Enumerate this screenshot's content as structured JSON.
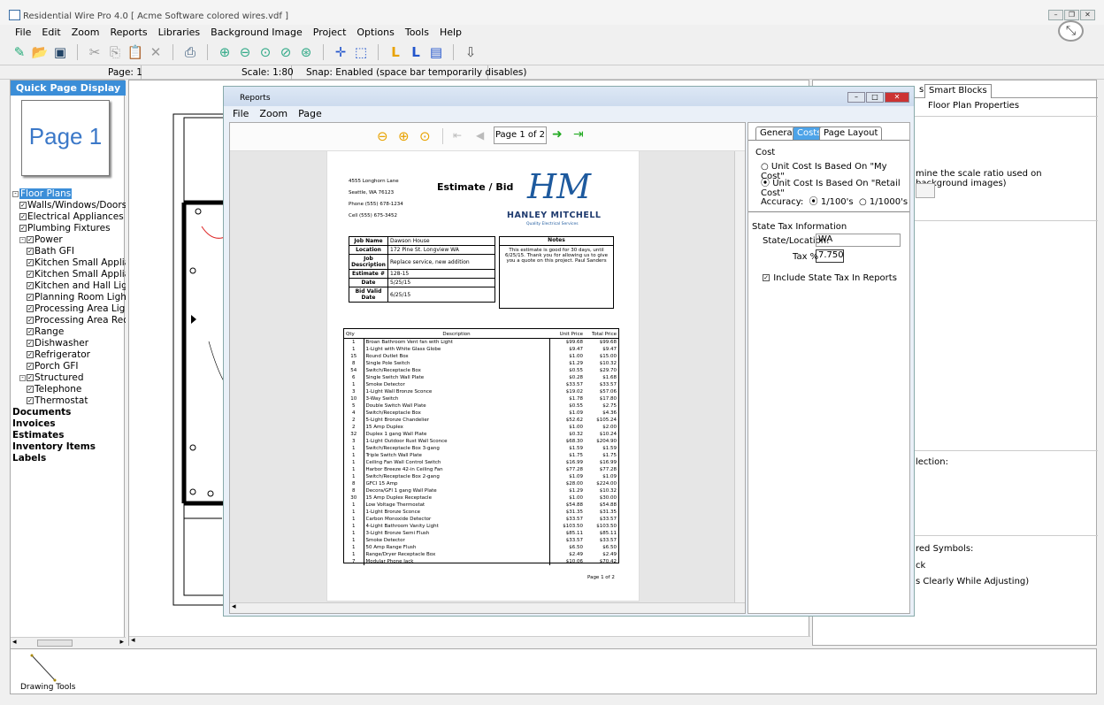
{
  "window": {
    "title": "Residential Wire Pro 4.0 [ Acme Software colored wires.vdf ]"
  },
  "menu": [
    "File",
    "Edit",
    "Zoom",
    "Reports",
    "Libraries",
    "Background Image",
    "Project",
    "Options",
    "Tools",
    "Help"
  ],
  "status": {
    "page": "Page: 1",
    "scale": "Scale: 1:80",
    "snap": "Snap: Enabled  (space bar temporarily disables)"
  },
  "left": {
    "header": "Quick Page Display",
    "thumb": "Page 1",
    "tree": [
      {
        "t": "Floor Plans",
        "lvl": 0,
        "exp": "-",
        "sel": true
      },
      {
        "t": "Walls/Windows/Doors",
        "lvl": 1,
        "cb": true
      },
      {
        "t": "Electrical Appliances",
        "lvl": 1,
        "cb": true
      },
      {
        "t": "Plumbing Fixtures",
        "lvl": 1,
        "cb": true
      },
      {
        "t": "Power",
        "lvl": 1,
        "cb": true,
        "exp": "-"
      },
      {
        "t": "Bath GFI",
        "lvl": 2,
        "cb": true
      },
      {
        "t": "Kitchen Small Applianc",
        "lvl": 2,
        "cb": true
      },
      {
        "t": "Kitchen Small Applianc",
        "lvl": 2,
        "cb": true
      },
      {
        "t": "Kitchen and Hall Lightin",
        "lvl": 2,
        "cb": true
      },
      {
        "t": "Planning Room Lights (",
        "lvl": 2,
        "cb": true
      },
      {
        "t": "Processing Area Lights",
        "lvl": 2,
        "cb": true
      },
      {
        "t": "Processing Area Rece",
        "lvl": 2,
        "cb": true
      },
      {
        "t": "Range",
        "lvl": 2,
        "cb": true
      },
      {
        "t": "Dishwasher",
        "lvl": 2,
        "cb": true
      },
      {
        "t": "Refrigerator",
        "lvl": 2,
        "cb": true
      },
      {
        "t": "Porch GFI",
        "lvl": 2,
        "cb": true
      },
      {
        "t": "Structured",
        "lvl": 1,
        "cb": true,
        "exp": "-"
      },
      {
        "t": "Telephone",
        "lvl": 2,
        "cb": true
      },
      {
        "t": "Thermostat",
        "lvl": 2,
        "cb": true
      },
      {
        "t": "Documents",
        "lvl": 0,
        "bold": true
      },
      {
        "t": "Invoices",
        "lvl": 0,
        "bold": true
      },
      {
        "t": "Estimates",
        "lvl": 0,
        "bold": true
      },
      {
        "t": "Inventory Items",
        "lvl": 0,
        "bold": true
      },
      {
        "t": "Labels",
        "lvl": 0,
        "bold": true
      }
    ]
  },
  "bottom": {
    "label": "Drawing Tools"
  },
  "right": {
    "tab_partial": "s",
    "tab_smart": "Smart Blocks",
    "heading": "Floor Plan Properties",
    "text1": "mine the scale ratio used on background images)",
    "text2": "lection:",
    "text3": "red Symbols:",
    "text4": "ck",
    "text5": "s Clearly While Adjusting)"
  },
  "reports": {
    "title": "Reports",
    "menu": [
      "File",
      "Zoom",
      "Page"
    ],
    "page_box": "Page 1 of 2",
    "tabs": [
      "General",
      "Costs",
      "Page Layout"
    ],
    "cost_label": "Cost",
    "opt1": "Unit Cost Is Based On \"My Cost\"",
    "opt2": "Unit Cost Is Based On \"Retail Cost\"",
    "accuracy_label": "Accuracy:",
    "acc1": "1/100's",
    "acc2": "1/1000's",
    "state_tax": "State Tax Information",
    "state_label": "State/Location:",
    "state_val": "WA",
    "tax_label": "Tax %",
    "tax_val": "7.750",
    "include": "Include State Tax In Reports",
    "doc": {
      "addr1": "4555 Longhorn Lane",
      "addr2": "Seattle, WA 76123",
      "addr3": "Phone (555) 678-1234",
      "addr4": "Cell (555) 675-3452",
      "heading": "Estimate / Bid",
      "logo": "HM",
      "company": "HANLEY MITCHELL",
      "tagline": "Quality Electrical Services",
      "job": [
        [
          "Job Name",
          "Dawson House"
        ],
        [
          "Location",
          "172 Pine St. Longview WA"
        ],
        [
          "Job Description",
          "Replace service, new addition"
        ],
        [
          "Estimate #",
          "128-15"
        ],
        [
          "Date",
          "5/25/15"
        ],
        [
          "Bid Valid Date",
          "6/25/15"
        ]
      ],
      "notes_h": "Notes",
      "notes": "This estimate is good for 30 days, until 6/25/15. Thank you for allowing us to give you a quote on this project. Paul Sanders",
      "cols": [
        "Qty",
        "Description",
        "Unit Price",
        "Total Price"
      ],
      "items": [
        [
          "1",
          "Broan Bathroom Vent fan with Light",
          "$99.68",
          "$99.68"
        ],
        [
          "1",
          "1-Light with White Glass Globe",
          "$9.47",
          "$9.47"
        ],
        [
          "15",
          "Round Outlet Box",
          "$1.00",
          "$15.00"
        ],
        [
          "8",
          "Single Pole Switch",
          "$1.29",
          "$10.32"
        ],
        [
          "54",
          "Switch/Receptacle Box",
          "$0.55",
          "$29.70"
        ],
        [
          "6",
          "Single Switch Wall Plate",
          "$0.28",
          "$1.68"
        ],
        [
          "1",
          "Smoke Detector",
          "$33.57",
          "$33.57"
        ],
        [
          "3",
          "1-Light Wall Bronze Sconce",
          "$19.02",
          "$57.06"
        ],
        [
          "10",
          "3-Way Switch",
          "$1.78",
          "$17.80"
        ],
        [
          "5",
          "Double Switch  Wall Plate",
          "$0.55",
          "$2.75"
        ],
        [
          "4",
          "Switch/Receptacle Box",
          "$1.09",
          "$4.36"
        ],
        [
          "2",
          "5-Light Bronze Chandelier",
          "$52.62",
          "$105.24"
        ],
        [
          "2",
          "15 Amp Duplex",
          "$1.00",
          "$2.00"
        ],
        [
          "32",
          "Duplex 1 gang  Wall Plate",
          "$0.32",
          "$10.24"
        ],
        [
          "3",
          "1-Light Outdoor Rust Wall Sconce",
          "$68.30",
          "$204.90"
        ],
        [
          "1",
          "Switch/Receptacle Box 3-gang",
          "$1.59",
          "$1.59"
        ],
        [
          "1",
          "Triple Switch  Wall Plate",
          "$1.75",
          "$1.75"
        ],
        [
          "1",
          "Ceiling Fan Wall Control Switch",
          "$16.99",
          "$16.99"
        ],
        [
          "1",
          "Harbor Breeze  42-in Ceiling Fan",
          "$77.28",
          "$77.28"
        ],
        [
          "1",
          "Switch/Receptacle Box 2-gang",
          "$1.09",
          "$1.09"
        ],
        [
          "8",
          "GFCI 15 Amp",
          "$28.00",
          "$224.00"
        ],
        [
          "8",
          "Decora/GFI 1 gang  Wall Plate",
          "$1.29",
          "$10.32"
        ],
        [
          "30",
          "15 Amp Duplex  Receptacle",
          "$1.00",
          "$30.00"
        ],
        [
          "1",
          "Low Voltage Thermostat",
          "$54.88",
          "$54.88"
        ],
        [
          "1",
          "1-Light  Bronze Sconce",
          "$31.35",
          "$31.35"
        ],
        [
          "1",
          "Carbon Monoxide Detector",
          "$33.57",
          "$33.57"
        ],
        [
          "1",
          "4-Light  Bathroom Vanity Light",
          "$103.50",
          "$103.50"
        ],
        [
          "1",
          "3-Light  Bronze Semi Flush",
          "$85.11",
          "$85.11"
        ],
        [
          "1",
          "Smoke Detector",
          "$33.57",
          "$33.57"
        ],
        [
          "1",
          "50 Amp Range Flush",
          "$6.50",
          "$6.50"
        ],
        [
          "1",
          "Range/Dryer Receptacle Box",
          "$2.49",
          "$2.49"
        ],
        [
          "7",
          "Modular Phone Jack",
          "$10.06",
          "$70.42"
        ]
      ],
      "footer": "Page 1 of 2"
    }
  }
}
